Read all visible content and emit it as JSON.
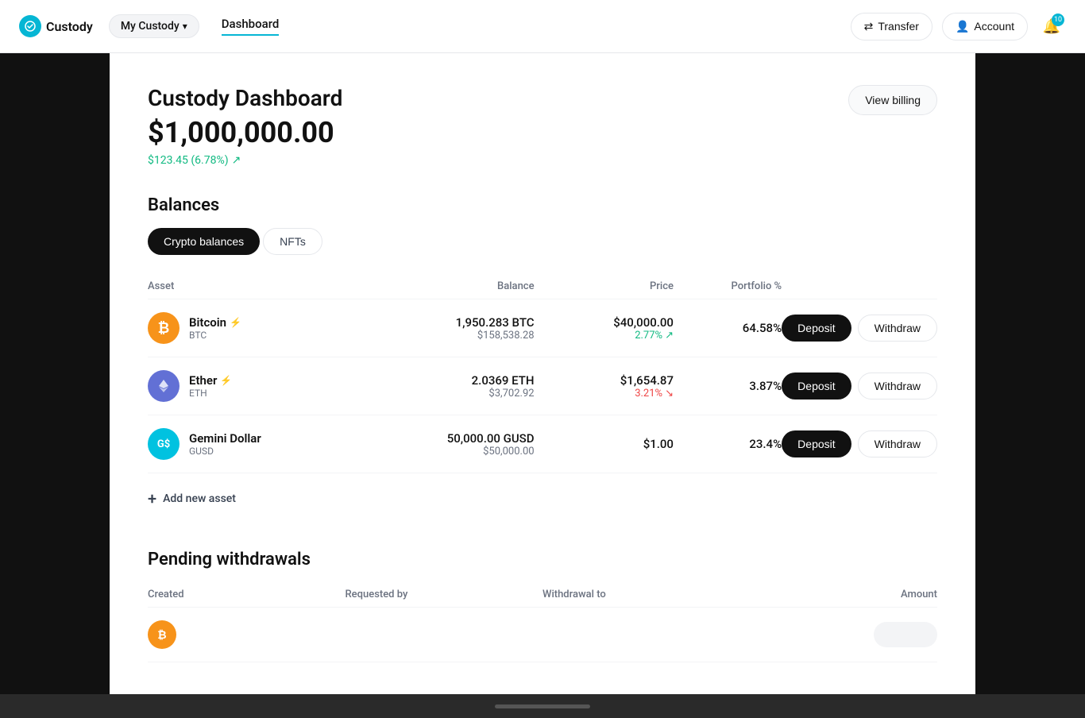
{
  "navbar": {
    "logo_label": "Custody",
    "my_custody_label": "My Custody",
    "tabs": [
      {
        "label": "Dashboard",
        "active": true
      }
    ],
    "transfer_label": "Transfer",
    "account_label": "Account",
    "notification_count": "10"
  },
  "dashboard": {
    "title": "Custody Dashboard",
    "balance": "$1,000,000.00",
    "change": "$123.45 (6.78%)",
    "view_billing_label": "View billing"
  },
  "balances": {
    "section_title": "Balances",
    "tabs": [
      {
        "label": "Crypto balances",
        "active": true
      },
      {
        "label": "NFTs",
        "active": false
      }
    ],
    "columns": {
      "asset": "Asset",
      "balance": "Balance",
      "price": "Price",
      "portfolio": "Portfolio %"
    },
    "assets": [
      {
        "icon": "₿",
        "icon_type": "btc",
        "name": "Bitcoin",
        "ticker": "BTC",
        "lightning": true,
        "balance_amount": "1,950.283 BTC",
        "balance_usd": "$158,538.28",
        "price": "$40,000.00",
        "price_change": "2.77%",
        "price_direction": "up",
        "portfolio": "64.58%",
        "deposit_label": "Deposit",
        "withdraw_label": "Withdraw"
      },
      {
        "icon": "⟠",
        "icon_type": "eth",
        "name": "Ether",
        "ticker": "ETH",
        "lightning": true,
        "balance_amount": "2.0369 ETH",
        "balance_usd": "$3,702.92",
        "price": "$1,654.87",
        "price_change": "3.21%",
        "price_direction": "down",
        "portfolio": "3.87%",
        "deposit_label": "Deposit",
        "withdraw_label": "Withdraw"
      },
      {
        "icon": "G$",
        "icon_type": "gusd",
        "name": "Gemini Dollar",
        "ticker": "GUSD",
        "lightning": false,
        "balance_amount": "50,000.00 GUSD",
        "balance_usd": "$50,000.00",
        "price": "$1.00",
        "price_change": "",
        "price_direction": "neutral",
        "portfolio": "23.4%",
        "deposit_label": "Deposit",
        "withdraw_label": "Withdraw"
      }
    ],
    "add_asset_label": "Add new asset"
  },
  "pending_withdrawals": {
    "section_title": "Pending withdrawals",
    "columns": {
      "created": "Created",
      "requested_by": "Requested by",
      "withdrawal_to": "Withdrawal to",
      "amount": "Amount"
    }
  }
}
